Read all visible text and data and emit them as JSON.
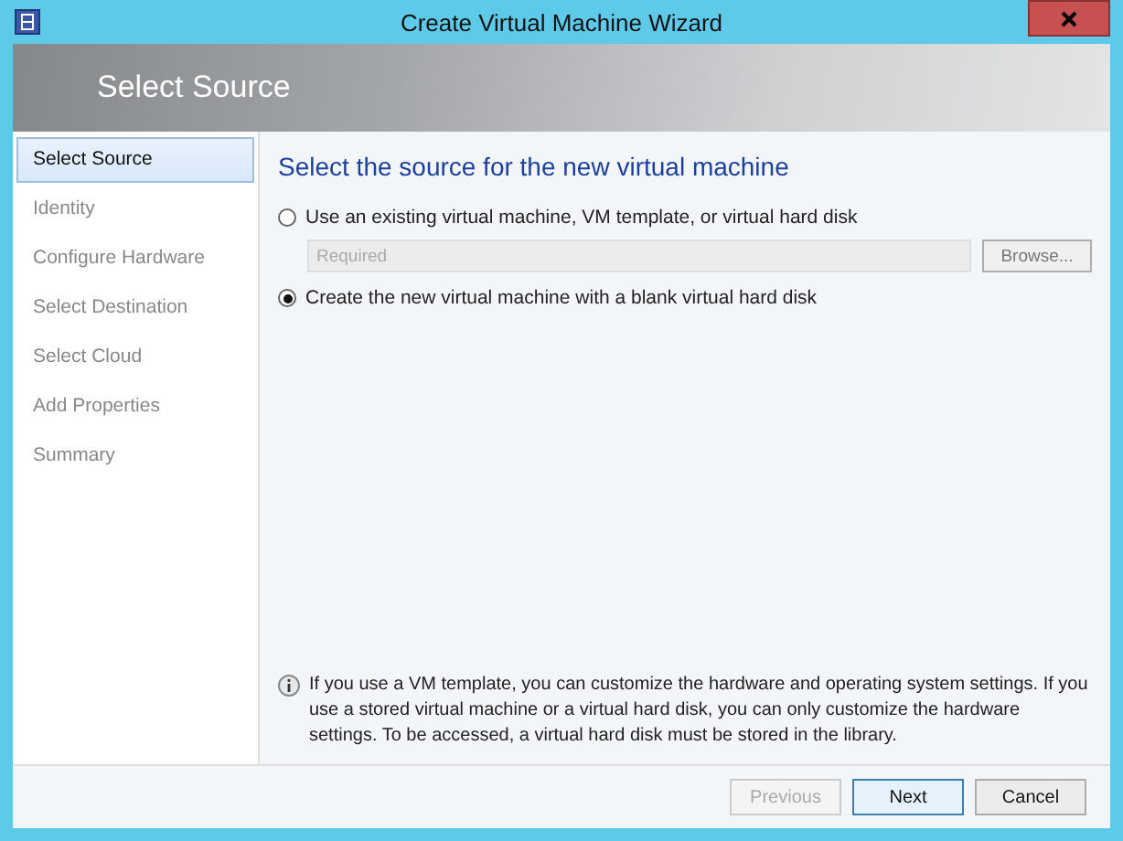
{
  "window": {
    "title": "Create Virtual Machine Wizard"
  },
  "header": {
    "title": "Select Source"
  },
  "steps": [
    {
      "label": "Select Source",
      "selected": true
    },
    {
      "label": "Identity",
      "selected": false
    },
    {
      "label": "Configure Hardware",
      "selected": false
    },
    {
      "label": "Select Destination",
      "selected": false
    },
    {
      "label": "Select Cloud",
      "selected": false
    },
    {
      "label": "Add Properties",
      "selected": false
    },
    {
      "label": "Summary",
      "selected": false
    }
  ],
  "heading": "Select the source for the new virtual machine",
  "options": [
    {
      "label": "Use an existing virtual machine, VM template, or virtual hard disk",
      "selected": false,
      "field": {
        "placeholder": "Required",
        "disabled": true
      },
      "button": "Browse..."
    },
    {
      "label": "Create the new virtual machine with a blank virtual hard disk",
      "selected": true
    }
  ],
  "info": "If you use a VM template, you can customize the hardware and operating system settings. If you use a stored virtual machine or a virtual hard disk, you can only customize the hardware settings. To be accessed, a virtual hard disk must be stored in the library.",
  "buttons": [
    {
      "label": "Previous",
      "disabled": true,
      "default": false
    },
    {
      "label": "Next",
      "disabled": false,
      "default": true
    },
    {
      "label": "Cancel",
      "disabled": false,
      "default": false
    }
  ]
}
